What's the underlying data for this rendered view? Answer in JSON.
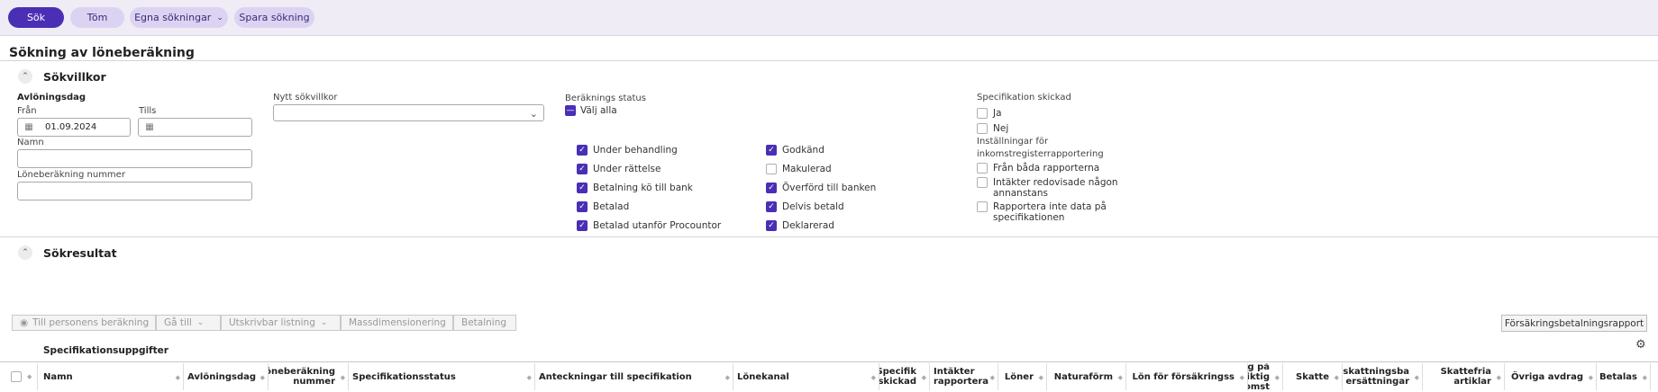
{
  "toolbar": {
    "search": "Sök",
    "clear": "Töm",
    "saved": "Egna sökningar",
    "save": "Spara sökning"
  },
  "page_title": "Sökning av löneberäkning",
  "criteria": {
    "title": "Sökvillkor",
    "payday_label": "Avlöningsdag",
    "from_label": "Från",
    "from_value": "01.09.2024",
    "to_label": "Tills",
    "to_value": "",
    "name_label": "Namn",
    "number_label": "Löneberäkning nummer",
    "new_criteria_label": "Nytt sökvillkor",
    "status_label": "Beräknings status",
    "select_all": "Välj alla",
    "status_left": [
      "Under behandling",
      "Under rättelse",
      "Betalning kö till bank",
      "Betalad",
      "Betalad utanför Procountor"
    ],
    "status_left_checked": [
      true,
      true,
      true,
      true,
      true
    ],
    "status_right": [
      "Godkänd",
      "Makulerad",
      "Överförd till banken",
      "Delvis betald",
      "Deklarerad"
    ],
    "status_right_checked": [
      true,
      false,
      true,
      true,
      true
    ],
    "spec_sent_label": "Specifikation skickad",
    "spec_yes": "Ja",
    "spec_no": "Nej",
    "income_reg_label": "Inställningar för inkomstregisterrapportering",
    "opt_both": "Från båda rapporterna",
    "opt_elsewhere": "Intäkter redovisade någon annanstans",
    "opt_not_report": "Rapportera inte data på specifikationen"
  },
  "results": {
    "title": "Sökresultat",
    "btn_person": "Till personens beräkning",
    "btn_goto": "Gå till",
    "btn_print": "Utskrivbar listning",
    "btn_mass": "Massdimensionering",
    "btn_pay": "Betalning",
    "btn_insurance": "Försäkringsbetalningsrapport",
    "group_header": "Specifikationsuppgifter",
    "columns": [
      "Namn",
      "Avlöningsdag",
      "Löneberäkning nummer",
      "Specifikationsstatus",
      "Anteckningar till specifikation",
      "Lönekanal",
      "Specifik skickad",
      "Intäkter rapportera",
      "Löner",
      "Naturaförm",
      "Lön för försäkringss",
      "Avdrag på skattepliktig inkomst",
      "Skatte",
      "Beskattningsba ersättningar",
      "Skattefria artiklar",
      "Övriga avdrag",
      "Betalas"
    ]
  }
}
